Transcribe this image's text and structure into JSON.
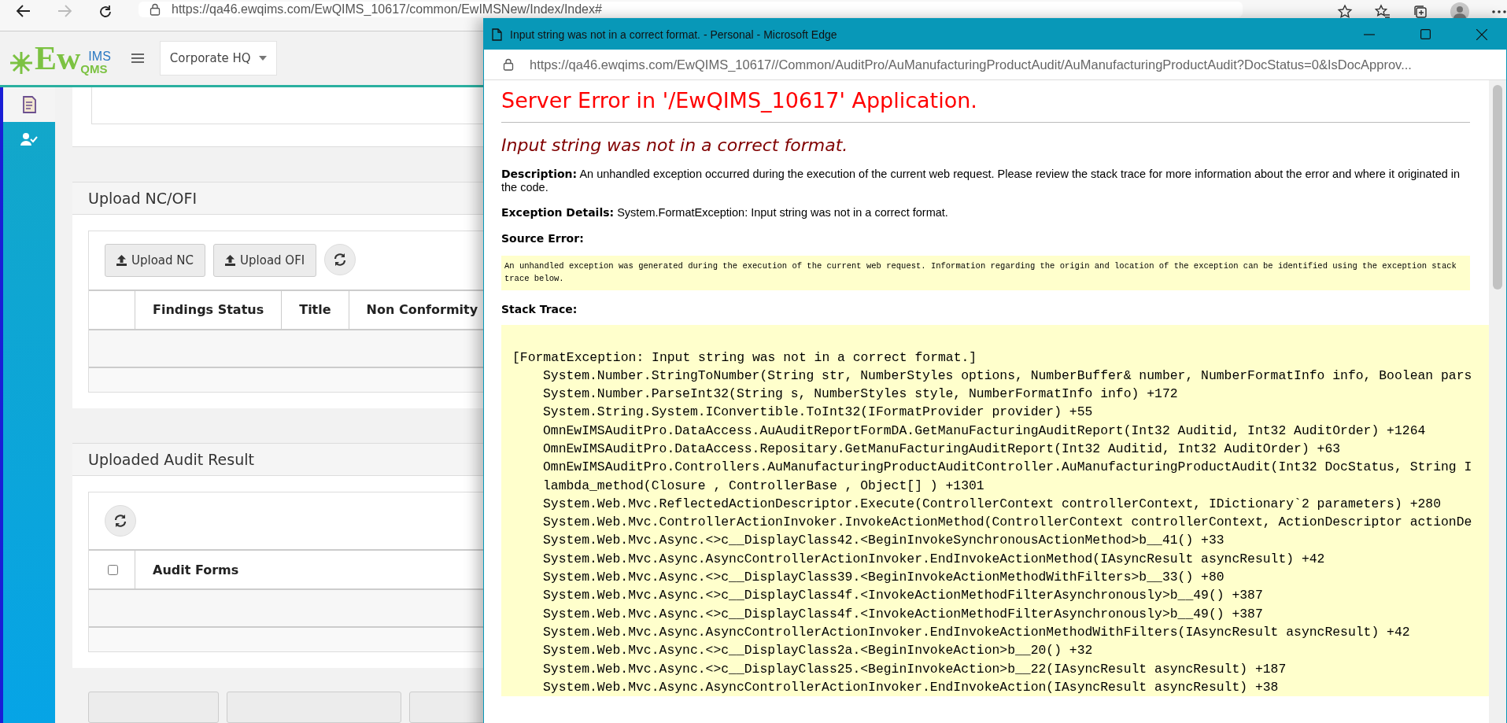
{
  "browser": {
    "url": "https://qa46.ewqims.com/EwQIMS_10617/common/EwIMSNew/Index/Index#"
  },
  "app_header": {
    "logo": {
      "main": "Ew",
      "top": "IMS",
      "bottom": "QMS"
    },
    "site_select": "Corporate HQ"
  },
  "sidebar": {
    "items": [
      {
        "selected": true
      },
      {
        "selected": false
      }
    ]
  },
  "sections": [
    {
      "kind": "upload",
      "title": "Upload NC/OFI",
      "buttons": [
        "Upload NC",
        "Upload OFI"
      ],
      "columns": [
        "Findings Status",
        "Title",
        "Non Conformity"
      ]
    },
    {
      "kind": "results",
      "title": "Uploaded Audit Result",
      "select_all": {
        "checked": false
      },
      "columns": [
        "Audit Forms"
      ]
    }
  ],
  "popup": {
    "title": "Input string was not in a correct format. - Personal - Microsoft Edge",
    "url": "https://qa46.ewqims.com/EwQIMS_10617//Common/AuditPro/AuManufacturingProductAudit/AuManufacturingProductAudit?DocStatus=0&IsDocApprov...",
    "heading": "Server Error in '/EwQIMS_10617' Application.",
    "message": "Input string was not in a correct format.",
    "details": [
      "**Description:** An unhandled exception occurred during the execution of the current web request. Please review the stack trace for more information about the error and where it originated in the code.",
      "**Exception Details:** System.FormatException: Input string was not in a correct format."
    ],
    "source_error": {
      "label": "Source Error:",
      "text": "An unhandled exception was generated during the execution of the current web request. Information regarding the origin and location of the exception can be identified using the exception stack trace below."
    },
    "stack_trace": {
      "label": "Stack Trace:",
      "exception": "[FormatException: Input string was not in a correct format.]",
      "frames": [
        "System.Number.StringToNumber(String str, NumberStyles options, NumberBuffer& number, NumberFormatInfo info, Boolean pars",
        "System.Number.ParseInt32(String s, NumberStyles style, NumberFormatInfo info) +172",
        "System.String.System.IConvertible.ToInt32(IFormatProvider provider) +55",
        "OmnEwIMSAuditPro.DataAccess.AuAuditReportFormDA.GetManuFacturingAuditReport(Int32 Auditid, Int32 AuditOrder) +1264",
        "OmnEwIMSAuditPro.DataAccess.Repositary.GetManuFacturingAuditReport(Int32 Auditid, Int32 AuditOrder) +63",
        "OmnEwIMSAuditPro.Controllers.AuManufacturingProductAuditController.AuManufacturingProductAudit(Int32 DocStatus, String I",
        "lambda_method(Closure , ControllerBase , Object[] ) +1301",
        "System.Web.Mvc.ReflectedActionDescriptor.Execute(ControllerContext controllerContext, IDictionary`2 parameters) +280",
        "System.Web.Mvc.ControllerActionInvoker.InvokeActionMethod(ControllerContext controllerContext, ActionDescriptor actionDe",
        "System.Web.Mvc.Async.<>c__DisplayClass42.<BeginInvokeSynchronousActionMethod>b__41() +33",
        "System.Web.Mvc.Async.AsyncControllerActionInvoker.EndInvokeActionMethod(IAsyncResult asyncResult) +42",
        "System.Web.Mvc.Async.<>c__DisplayClass39.<BeginInvokeActionMethodWithFilters>b__33() +80",
        "System.Web.Mvc.Async.<>c__DisplayClass4f.<InvokeActionMethodFilterAsynchronously>b__49() +387",
        "System.Web.Mvc.Async.<>c__DisplayClass4f.<InvokeActionMethodFilterAsynchronously>b__49() +387",
        "System.Web.Mvc.Async.AsyncControllerActionInvoker.EndInvokeActionMethodWithFilters(IAsyncResult asyncResult) +42",
        "System.Web.Mvc.Async.<>c__DisplayClass2a.<BeginInvokeAction>b__20() +32",
        "System.Web.Mvc.Async.<>c__DisplayClass25.<BeginInvokeAction>b__22(IAsyncResult asyncResult) +187",
        "System.Web.Mvc.Async.AsyncControllerActionInvoker.EndInvokeAction(IAsyncResult asyncResult) +38"
      ]
    }
  }
}
